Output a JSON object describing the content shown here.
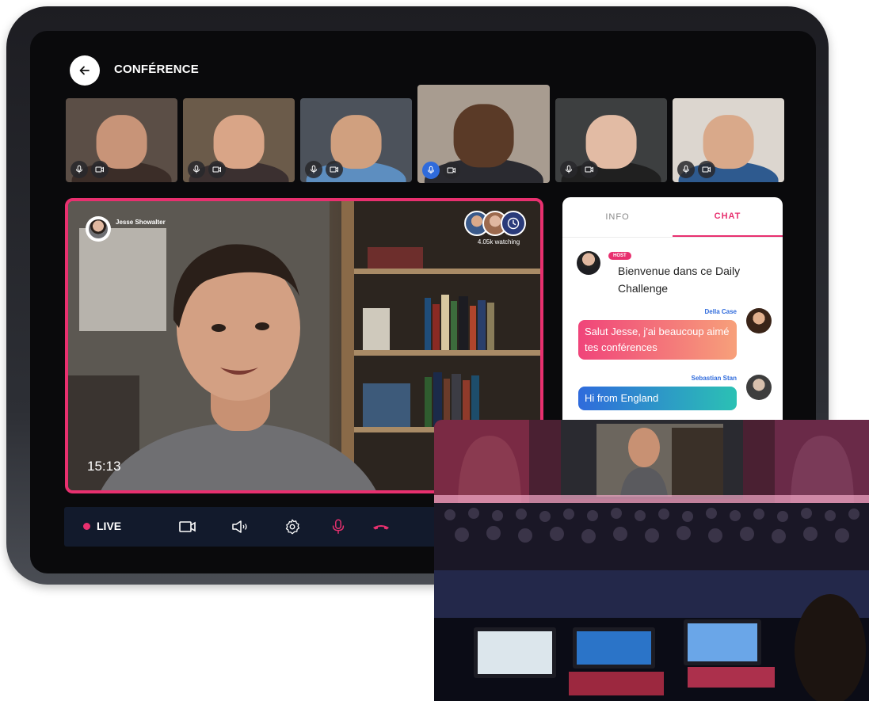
{
  "header": {
    "title": "CONFÉRENCE"
  },
  "participants": [
    {
      "bg": "#5b4e46",
      "face": "#c89478",
      "shirt": "#3b2d28",
      "mic_active": false
    },
    {
      "bg": "#6b5b4a",
      "face": "#d9a587",
      "shirt": "#3b3030",
      "mic_active": false
    },
    {
      "bg": "#4c525b",
      "face": "#d0a07f",
      "shirt": "#5d8ec0",
      "mic_active": false
    },
    {
      "bg": "#a89c90",
      "face": "#5a3a27",
      "shirt": "#2a2a30",
      "mic_active": true
    },
    {
      "bg": "#3d3f40",
      "face": "#e2bba4",
      "shirt": "#202020",
      "mic_active": false
    },
    {
      "bg": "#dcd6cf",
      "face": "#d9a98a",
      "shirt": "#2e5a8f",
      "mic_active": false
    }
  ],
  "main_video": {
    "presenter_name": "Jesse Showalter",
    "watching": "4.05k watching",
    "timer": "15:13"
  },
  "chat": {
    "tabs": [
      {
        "label": "INFO",
        "active": false
      },
      {
        "label": "CHAT",
        "active": true
      }
    ],
    "host_badge": "HOST",
    "host_message": "Bienvenue dans ce Daily Challenge",
    "messages": [
      {
        "author": "Della Case",
        "text": "Salut Jesse, j'ai beaucoup aimé tes conférences",
        "gradient": [
          "#f0447a",
          "#f7a07a"
        ]
      },
      {
        "author": "Sebastian Stan",
        "text": "Hi from England",
        "gradient": [
          "#2f6bdc",
          "#2bc1b4"
        ]
      }
    ]
  },
  "controls": {
    "live_label": "LIVE"
  },
  "colors": {
    "accent": "#e8306f",
    "blue": "#2f6bdc"
  }
}
